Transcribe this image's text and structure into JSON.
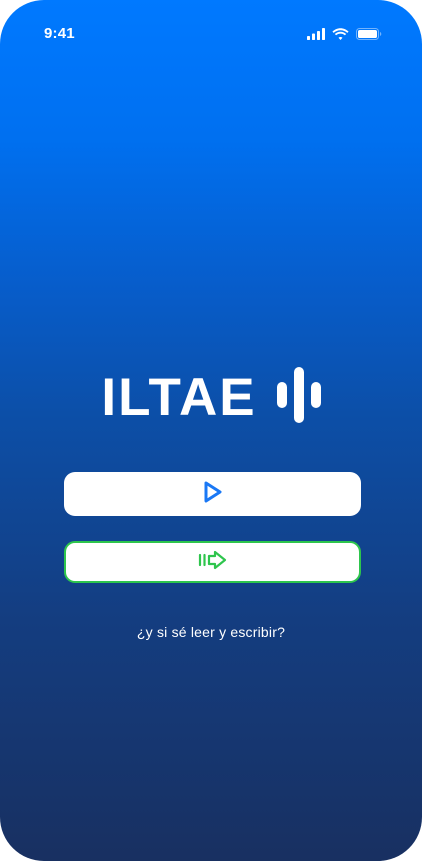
{
  "status_bar": {
    "time": "9:41",
    "icons": [
      "signal-icon",
      "wifi-icon",
      "battery-icon"
    ]
  },
  "logo": {
    "text": "ILTAE",
    "mark_icon": "audio-wave-icon"
  },
  "buttons": {
    "play": {
      "icon": "play-icon"
    },
    "next": {
      "icon": "arrow-right-icon"
    }
  },
  "links": {
    "question": "¿y si sé leer y escribir?"
  },
  "colors": {
    "gradient_top": "#0079ff",
    "gradient_bottom": "#183061",
    "play_icon": "#1a78f5",
    "next_accent": "#2ec54d",
    "text": "#ffffff"
  }
}
